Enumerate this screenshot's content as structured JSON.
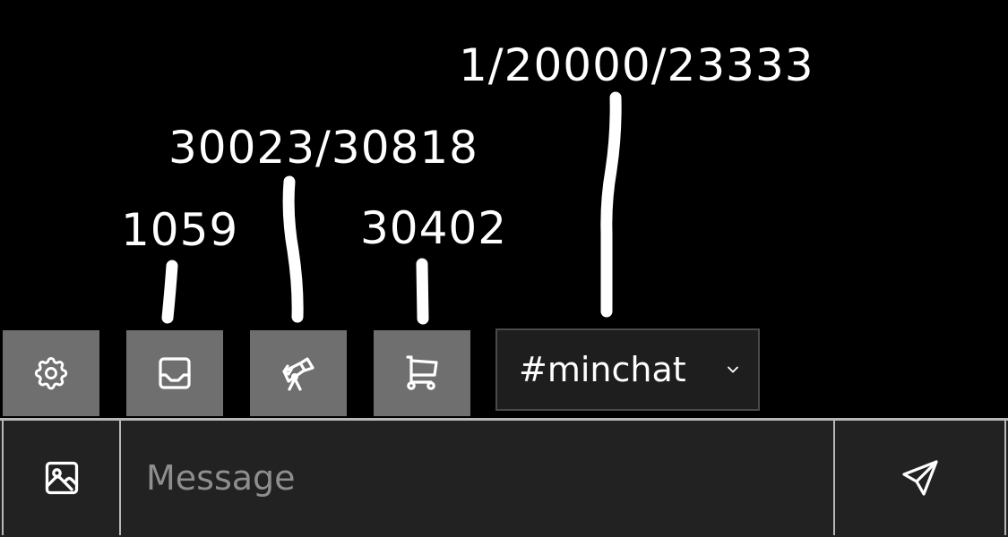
{
  "annotations": [
    {
      "label": "1/20000/23333"
    },
    {
      "label": "30023/30818"
    },
    {
      "label": "1059"
    },
    {
      "label": "30402"
    }
  ],
  "toolbar": {
    "buttons": [
      {
        "icon": "gear-icon"
      },
      {
        "icon": "inbox-icon"
      },
      {
        "icon": "telescope-icon"
      },
      {
        "icon": "shopping-cart-icon"
      }
    ],
    "channel_select": {
      "value": "#minchat",
      "icon": "chevron-down-icon"
    }
  },
  "composer": {
    "image_button_icon": "image-icon",
    "message_placeholder": "Message",
    "message_value": "",
    "send_button_icon": "send-icon"
  },
  "colors": {
    "background": "#000000",
    "button_gray": "#6f6f6f",
    "dark_panel": "#222222",
    "border": "#b8b8b8",
    "placeholder": "#8e8e8e"
  }
}
